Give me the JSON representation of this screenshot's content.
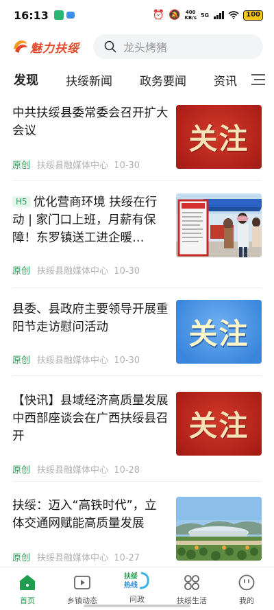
{
  "status_bar": {
    "time": "16:13",
    "net_speed_value": "400",
    "net_speed_unit": "KB/s",
    "network": "5G",
    "battery": "100"
  },
  "header": {
    "logo_text": "魅力扶绥",
    "search_placeholder": "龙头烤猪"
  },
  "tabs": [
    {
      "label": "发现",
      "active": true
    },
    {
      "label": "扶绥新闻"
    },
    {
      "label": "政务要闻"
    },
    {
      "label": "资讯"
    }
  ],
  "feed": [
    {
      "title": "中共扶绥县委常委会召开扩大会议",
      "tag": "原创",
      "source": "扶绥县融媒体中心",
      "date": "10-30",
      "thumb_text": "关注",
      "thumb_style": "red"
    },
    {
      "badge": "H5",
      "title": "优化营商环境 扶绥在行动 | 家门口上班，月薪有保障！东罗镇送工进企暖…",
      "tag": "原创",
      "source": "扶绥县融媒体中心",
      "date": "10-30",
      "thumb_style": "photo-tent"
    },
    {
      "title": "县委、县政府主要领导开展重阳节走访慰问活动",
      "tag": "原创",
      "source": "扶绥县融媒体中心",
      "date": "10-30",
      "thumb_text": "关注",
      "thumb_style": "blue"
    },
    {
      "title": "【快讯】县域经济高质量发展中西部座谈会在广西扶绥县召开",
      "tag": "原创",
      "source": "扶绥县融媒体中心",
      "date": "10-28",
      "thumb_text": "关注",
      "thumb_style": "red"
    },
    {
      "title": "扶绥：迈入“高铁时代”，立体交通网赋能高质量发展",
      "tag": "原创",
      "source": "扶绥县融媒体中心",
      "date": "10-27",
      "thumb_style": "photo-station"
    }
  ],
  "bottom_nav": [
    {
      "label": "首页",
      "icon": "home-icon",
      "active": true
    },
    {
      "label": "乡镇动态",
      "icon": "play-icon"
    },
    {
      "label": "问政",
      "icon": "hotline-icon",
      "icon_text": "扶绥热线"
    },
    {
      "label": "扶绥生活",
      "icon": "grid-icon"
    },
    {
      "label": "我的",
      "icon": "face-icon"
    }
  ],
  "colors": {
    "accent_green": "#1f9e4f",
    "tag_green": "#2a9d55",
    "thumb_red": "#b3221a",
    "thumb_blue": "#3a86dc"
  }
}
